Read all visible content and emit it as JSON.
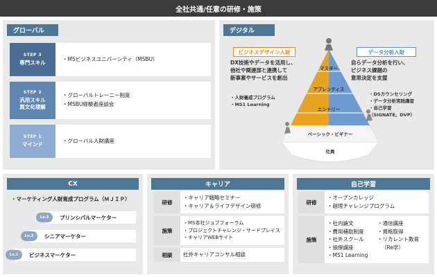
{
  "title": "全社共通/任意の研修・施策",
  "global": {
    "header": "グローバル",
    "rows": [
      {
        "step": "STEP 3",
        "name": [
          "専門スキル"
        ],
        "items": [
          "・MSビジネスユニバーシティ（MSBU）"
        ],
        "color": "#4a6d96"
      },
      {
        "step": "STEP 2",
        "name": [
          "汎用スキル",
          "異文化理解"
        ],
        "items": [
          "・グローバルトレーニー制度",
          "・MSBU経験者座談会"
        ],
        "color": "#5f86b0"
      },
      {
        "step": "STEP 1",
        "name": [
          "マインド"
        ],
        "items": [
          "・グローバル人財講座"
        ],
        "color": "#8fadd2"
      }
    ]
  },
  "digital": {
    "header": "デジタル",
    "left_label": "ビジネスデザイン人財",
    "right_label": "データ分析人財",
    "left_text": [
      "DX技術やデータを活用し、",
      "他社や関連部と連携して",
      "新事業やサービスを創出"
    ],
    "right_text": [
      "自らデータ分析を行い、",
      "ビジネス課題の",
      "意思決定を支援"
    ],
    "left_list": [
      "・人財養成プログラム",
      "・MS1 Learning"
    ],
    "right_list": [
      "・DSカウンセリング",
      "・データ分析実践講習",
      "・自己学習",
      "（SIGNATE、DVP）"
    ],
    "levels": [
      "マスター",
      "アプレンティス",
      "エントリー",
      "ベーシック・ビギナー",
      "社員"
    ],
    "colors": {
      "orange": "#e8a321",
      "blue": "#6f9bd0",
      "orange_label": "#e88b1e",
      "blue_label": "#5b8fc9"
    }
  },
  "cx": {
    "header": "CX",
    "program": "・マーケティング人財育成プログラム（ＭＪＩＰ）",
    "rows": [
      {
        "lv": "Lv.3",
        "label": "プリンシパルマーケター"
      },
      {
        "lv": "Lv.2",
        "label": "シニアマーケター"
      },
      {
        "lv": "Lv.1",
        "label": "ビジネスマーケター"
      }
    ]
  },
  "career": {
    "header": "キャリア",
    "rows": [
      {
        "cat": "研修",
        "items": [
          "・キャリア戦略セミナー",
          "・キャリア＆ライフデザイン研修"
        ]
      },
      {
        "cat": "施策",
        "items": [
          "・MS本社ジョブフォーラム",
          "・プロジェクトチャレンジ・サードプレイス",
          "・キャリアWEBサイト"
        ]
      },
      {
        "cat": "相談",
        "items": [
          "社外キャリアコンサル相談"
        ]
      }
    ]
  },
  "self": {
    "header": "自己学習",
    "training": {
      "cat": "研修",
      "items": [
        "・オープンカレッジ",
        "・越境チャレンジプログラム"
      ]
    },
    "measures": {
      "cat": "施策",
      "col1": [
        "・社内論文",
        "・費用補助制度",
        "・社外スクール",
        "・損保講座",
        "・MS1 Learning"
      ],
      "col2": [
        "・通信講座",
        "・資格取得",
        "・リカレント教育",
        "（Re学）"
      ]
    }
  }
}
